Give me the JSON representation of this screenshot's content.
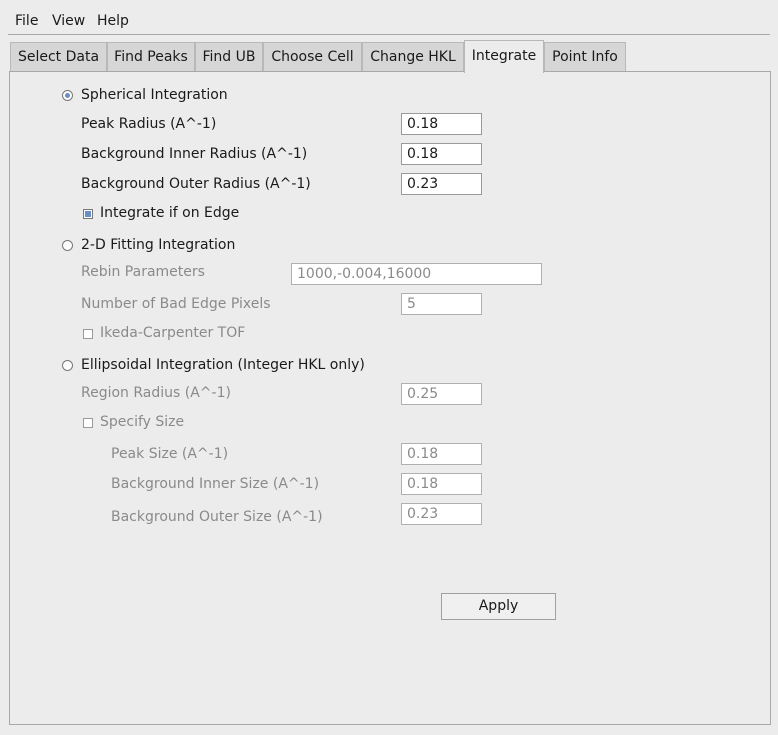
{
  "menu": [
    "File",
    "View",
    "Help"
  ],
  "tabs": [
    "Select Data",
    "Find Peaks",
    "Find UB",
    "Choose Cell",
    "Change HKL",
    "Integrate",
    "Point Info"
  ],
  "active_tab": "Integrate",
  "spherical": {
    "label": "Spherical Integration",
    "selected": true,
    "peak_radius": {
      "label": "Peak Radius (A^-1)",
      "value": "0.18"
    },
    "bg_inner": {
      "label": "Background Inner Radius (A^-1)",
      "value": "0.18"
    },
    "bg_outer": {
      "label": "Background Outer Radius (A^-1)",
      "value": "0.23"
    },
    "edge": {
      "label": "Integrate if on Edge",
      "checked": true
    }
  },
  "fitting": {
    "label": "2-D Fitting Integration",
    "selected": false,
    "rebin": {
      "label": "Rebin Parameters",
      "value": "1000,-0.004,16000"
    },
    "bad_edge": {
      "label": "Number of Bad Edge Pixels",
      "value": "5"
    },
    "ikeda": {
      "label": "Ikeda-Carpenter TOF",
      "checked": false
    }
  },
  "ellipsoidal": {
    "label": "Ellipsoidal Integration (Integer HKL only)",
    "selected": false,
    "region": {
      "label": "Region Radius (A^-1)",
      "value": "0.25"
    },
    "specify": {
      "label": "Specify Size",
      "checked": false
    },
    "peak_size": {
      "label": "Peak Size (A^-1)",
      "value": "0.18"
    },
    "bg_inner": {
      "label": "Background Inner Size (A^-1)",
      "value": "0.18"
    },
    "bg_outer": {
      "label": "Background Outer Size (A^-1)",
      "value": "0.23"
    }
  },
  "apply_label": "Apply"
}
